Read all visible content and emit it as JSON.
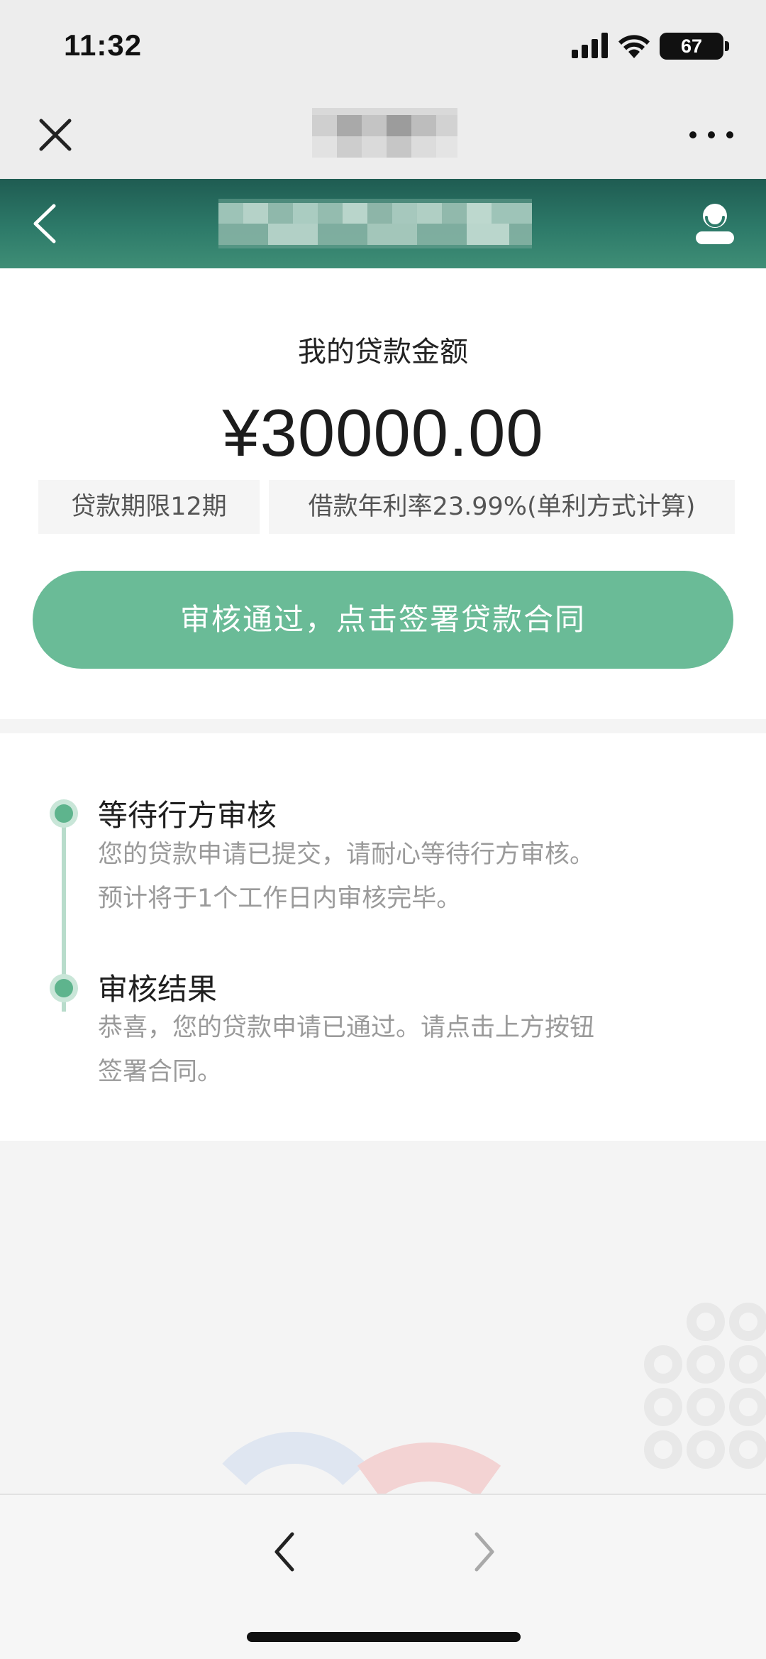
{
  "status_bar": {
    "time": "11:32",
    "battery": "67",
    "icons": [
      "signal-icon",
      "wifi-icon",
      "battery-icon"
    ]
  },
  "title_bar": {
    "icons": [
      "close-icon",
      "more-icon"
    ]
  },
  "header": {
    "icons": [
      "chevron-left-icon",
      "user-icon"
    ],
    "color": "#2d7a69"
  },
  "loan": {
    "label": "我的贷款金额",
    "amount": "¥30000.00",
    "term": "贷款期限12期",
    "rate": "借款年利率23.99%(单利方式计算)",
    "sign_button": "审核通过，点击签署贷款合同",
    "button_color": "#6abb97"
  },
  "progress": {
    "steps": [
      {
        "title": "等待行方审核",
        "desc": [
          "您的贷款申请已提交，请耐心等待行方审核。",
          "预计将于1个工作日内审核完毕。"
        ]
      },
      {
        "title": "审核结果",
        "desc": [
          "恭喜，您的贷款申请已通过。请点击上方按钮",
          "签署合同。"
        ]
      }
    ],
    "accent_color": "#5eb48d"
  },
  "bottom_nav": {
    "icons": [
      "chevron-left-icon",
      "chevron-right-icon"
    ]
  }
}
